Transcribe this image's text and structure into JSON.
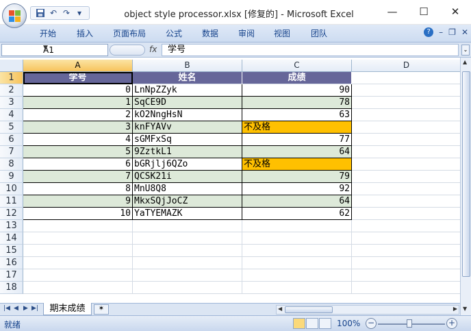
{
  "window": {
    "title": "object style processor.xlsx [修复的] - Microsoft Excel",
    "min_label": "—",
    "max_label": "☐",
    "close_label": "✕"
  },
  "qat": {
    "save_icon": "floppy-disk-icon",
    "undo": "↶",
    "redo": "↷",
    "customize": "▾"
  },
  "ribbon": {
    "tabs": [
      "开始",
      "插入",
      "页面布局",
      "公式",
      "数据",
      "审阅",
      "视图",
      "团队"
    ],
    "help": "?",
    "min": "–",
    "restore": "❐",
    "close": "✕"
  },
  "formula_bar": {
    "name_box": "A1",
    "fx": "fx",
    "content": "学号"
  },
  "columns": [
    "A",
    "B",
    "C",
    "D"
  ],
  "rows": [
    "1",
    "2",
    "3",
    "4",
    "5",
    "6",
    "7",
    "8",
    "9",
    "10",
    "11",
    "12",
    "13",
    "14",
    "15",
    "16",
    "17",
    "18"
  ],
  "table": {
    "headers": [
      "学号",
      "姓名",
      "成绩"
    ],
    "rows": [
      {
        "id": "0",
        "name": "LnNpZZyk",
        "score": "90",
        "fail": false,
        "green": false
      },
      {
        "id": "1",
        "name": "SqCE9D",
        "score": "78",
        "fail": false,
        "green": true
      },
      {
        "id": "2",
        "name": "kO2NngHsN",
        "score": "63",
        "fail": false,
        "green": false
      },
      {
        "id": "3",
        "name": "knFYAVv",
        "score": "不及格",
        "fail": true,
        "green": true
      },
      {
        "id": "4",
        "name": "sGMFxSq",
        "score": "77",
        "fail": false,
        "green": false
      },
      {
        "id": "5",
        "name": "9ZztkL1",
        "score": "64",
        "fail": false,
        "green": true
      },
      {
        "id": "6",
        "name": "bGRjlj6QZo",
        "score": "不及格",
        "fail": true,
        "green": false
      },
      {
        "id": "7",
        "name": "QCSK21i",
        "score": "79",
        "fail": false,
        "green": true
      },
      {
        "id": "8",
        "name": "MnU8Q8",
        "score": "92",
        "fail": false,
        "green": false
      },
      {
        "id": "9",
        "name": "MkxSQjJoCZ",
        "score": "64",
        "fail": false,
        "green": true
      },
      {
        "id": "10",
        "name": "YaTYEMAZK",
        "score": "62",
        "fail": false,
        "green": false
      }
    ]
  },
  "sheets": {
    "active": "期末成绩"
  },
  "status": {
    "text": "就绪",
    "zoom": "100%",
    "zoom_minus": "−",
    "zoom_plus": "+"
  },
  "colors": {
    "header_bg": "#666699",
    "green_row": "#dde9d9",
    "fail_bg": "#ffc000"
  }
}
